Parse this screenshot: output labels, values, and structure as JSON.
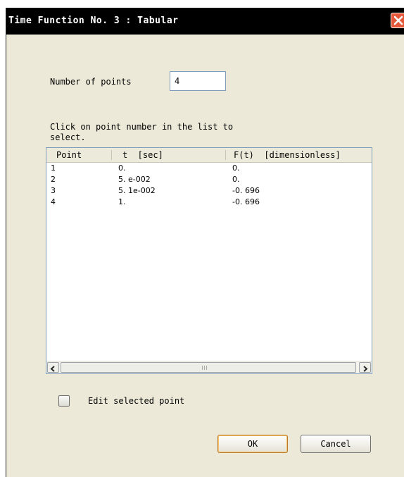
{
  "window": {
    "title": "Time Function No. 3 : Tabular"
  },
  "form": {
    "num_points_label": "Number of points",
    "num_points_value": "4",
    "instructions": "Click on point number in the list to\nselect."
  },
  "list": {
    "headers": [
      "Point",
      "t  [sec]",
      "F(t)  [dimensionless]"
    ],
    "rows": [
      [
        "1",
        "0.",
        "0."
      ],
      [
        "2",
        "5. e-002",
        "0."
      ],
      [
        "3",
        "5. 1e-002",
        "-0. 696"
      ],
      [
        "4",
        "1.",
        "-0. 696"
      ]
    ]
  },
  "options": {
    "edit_selected_label": "Edit selected point",
    "edit_selected_checked": false
  },
  "buttons": {
    "ok": "OK",
    "cancel": "Cancel"
  },
  "icons": {
    "close": "close-icon",
    "scroll_left": "scroll-left-arrow-icon",
    "scroll_right": "scroll-right-arrow-icon"
  },
  "colors": {
    "titlebar": "#000000",
    "close_button": "#e5583a",
    "dialog_bg": "#ece9d8"
  }
}
